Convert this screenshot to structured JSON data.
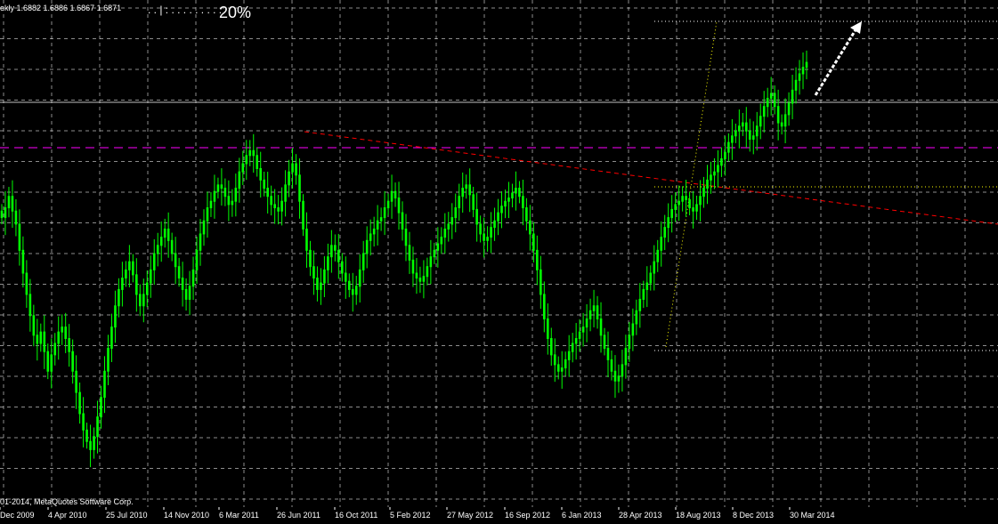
{
  "header": {
    "quote": "ekly  1.6882 1.6886 1.6867 1.6871",
    "progress_dots": ". . | : . . . . . . . . :",
    "progress_percent": "20%",
    "progress_value": 0.2
  },
  "footer": {
    "copyright": "01-2014, MetaQuotes Software Corp."
  },
  "colors": {
    "background": "#000000",
    "grid": "#ffffff",
    "candle": "#00ff00",
    "trendline": "#ff0000",
    "magenta_level": "#ff00ff",
    "yellow_lines": "#ffff00",
    "arrow": "#ffffff",
    "axis_text": "#ffffff"
  },
  "chart_data": {
    "type": "candlestick",
    "x_ticks": [
      "Dec 2009",
      "4 Apr 2010",
      "25 Jul 2010",
      "14 Nov 2010",
      "6 Mar 2011",
      "26 Jun 2011",
      "16 Oct 2011",
      "5 Feb 2012",
      "27 May 2012",
      "16 Sep 2012",
      "6 Jan 2013",
      "28 Apr 2013",
      "18 Aug 2013",
      "8 Dec 2013",
      "30 Mar 2014"
    ],
    "y_range": [
      1.42,
      1.72
    ],
    "close_series": [
      1.592,
      1.598,
      1.605,
      1.596,
      1.588,
      1.572,
      1.558,
      1.545,
      1.532,
      1.52,
      1.515,
      1.522,
      1.51,
      1.498,
      1.508,
      1.515,
      1.522,
      1.525,
      1.518,
      1.51,
      1.498,
      1.485,
      1.472,
      1.462,
      1.455,
      1.45,
      1.458,
      1.47,
      1.482,
      1.498,
      1.512,
      1.525,
      1.538,
      1.548,
      1.555,
      1.56,
      1.565,
      1.557,
      1.545,
      1.538,
      1.545,
      1.552,
      1.56,
      1.57,
      1.575,
      1.58,
      1.585,
      1.578,
      1.57,
      1.562,
      1.555,
      1.548,
      1.542,
      1.55,
      1.56,
      1.572,
      1.582,
      1.59,
      1.598,
      1.602,
      1.608,
      1.612,
      1.61,
      1.605,
      1.6,
      1.602,
      1.61,
      1.62,
      1.625,
      1.63,
      1.633,
      1.63,
      1.622,
      1.615,
      1.61,
      1.605,
      1.6,
      1.598,
      1.596,
      1.602,
      1.612,
      1.62,
      1.625,
      1.618,
      1.602,
      1.585,
      1.572,
      1.562,
      1.555,
      1.548,
      1.552,
      1.56,
      1.568,
      1.575,
      1.572,
      1.565,
      1.558,
      1.553,
      1.548,
      1.545,
      1.55,
      1.56,
      1.57,
      1.578,
      1.582,
      1.585,
      1.59,
      1.592,
      1.598,
      1.602,
      1.608,
      1.604,
      1.595,
      1.585,
      1.575,
      1.566,
      1.558,
      1.555,
      1.553,
      1.556,
      1.562,
      1.568,
      1.572,
      1.576,
      1.58,
      1.585,
      1.588,
      1.592,
      1.598,
      1.605,
      1.61,
      1.612,
      1.606,
      1.597,
      1.588,
      1.582,
      1.578,
      1.58,
      1.586,
      1.59,
      1.595,
      1.599,
      1.602,
      1.604,
      1.607,
      1.61,
      1.605,
      1.598,
      1.59,
      1.582,
      1.572,
      1.56,
      1.545,
      1.53,
      1.518,
      1.508,
      1.502,
      1.498,
      1.5,
      1.505,
      1.51,
      1.515,
      1.518,
      1.522,
      1.525,
      1.53,
      1.535,
      1.538,
      1.53,
      1.52,
      1.512,
      1.505,
      1.498,
      1.492,
      1.495,
      1.502,
      1.512,
      1.52,
      1.527,
      1.535,
      1.542,
      1.548,
      1.552,
      1.558,
      1.565,
      1.572,
      1.58,
      1.586,
      1.592,
      1.597,
      1.6,
      1.602,
      1.605,
      1.603,
      1.598,
      1.596,
      1.6,
      1.605,
      1.61,
      1.615,
      1.618,
      1.62,
      1.624,
      1.628,
      1.632,
      1.638,
      1.642,
      1.645,
      1.648,
      1.65,
      1.645,
      1.64,
      1.642,
      1.648,
      1.654,
      1.66,
      1.665,
      1.668,
      1.66,
      1.65,
      1.648,
      1.655,
      1.662,
      1.67,
      1.676,
      1.68,
      1.684,
      1.687
    ]
  }
}
